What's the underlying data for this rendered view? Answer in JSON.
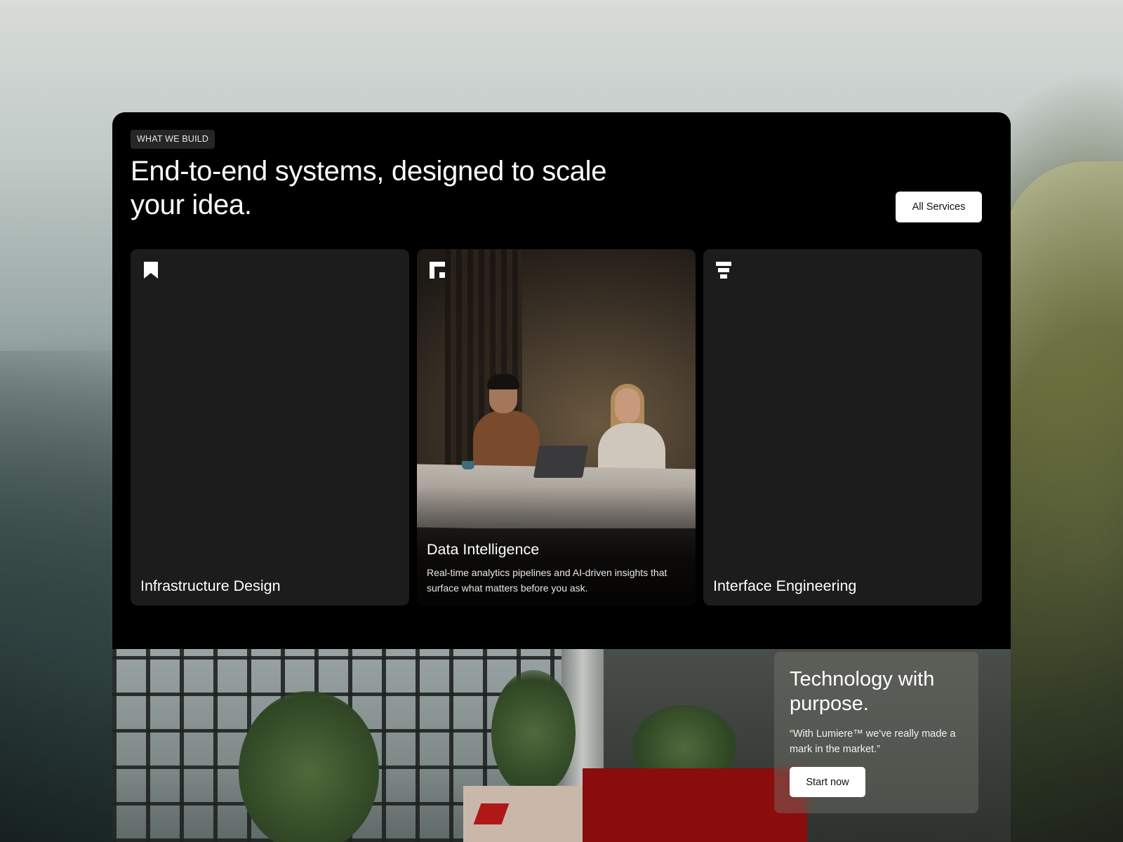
{
  "section": {
    "eyebrow": "WHAT WE BUILD",
    "headline": "End-to-end systems, designed to scale your idea.",
    "all_services_label": "All Services"
  },
  "cards": [
    {
      "title": "Infrastructure Design",
      "icon": "bookmark-icon"
    },
    {
      "title": "Data Intelligence",
      "icon": "corner-bracket-icon",
      "description": "Real-time analytics pipelines and AI-driven insights that surface what matters before you ask."
    },
    {
      "title": "Interface Engineering",
      "icon": "stacked-bars-icon"
    }
  ],
  "cta": {
    "title": "Technology with purpose.",
    "quote": "“With Lumiere™ we've really made a mark in the market.”",
    "button_label": "Start now"
  },
  "colors": {
    "panel_bg": "#000000",
    "card_bg": "#1c1c1c",
    "accent_red": "#8a0c0c"
  }
}
